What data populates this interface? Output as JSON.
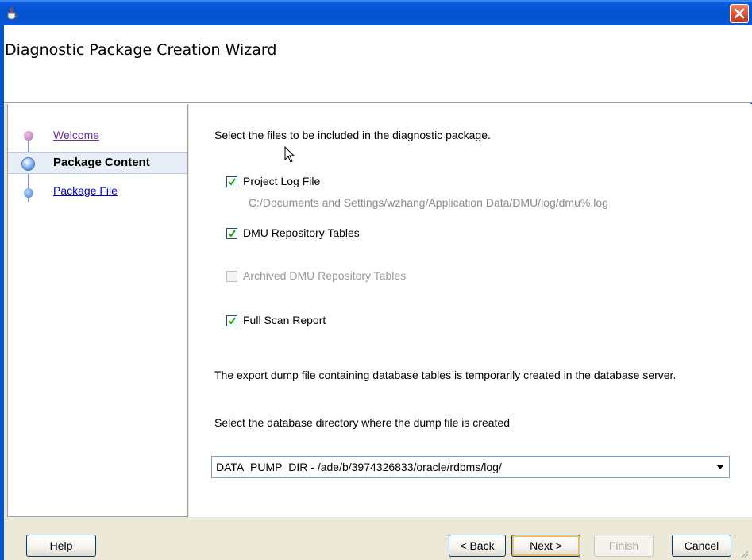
{
  "window": {
    "title": "",
    "icon": "java-cup-icon",
    "close_icon": "close-icon"
  },
  "header": {
    "title": "Diagnostic Package Creation Wizard"
  },
  "nav": {
    "items": [
      {
        "label": "Welcome",
        "state": "visited"
      },
      {
        "label": "Package Content",
        "state": "current"
      },
      {
        "label": "Package File",
        "state": "pending"
      }
    ]
  },
  "content": {
    "instruction": "Select the files to be included in the diagnostic package.",
    "options": [
      {
        "label": "Project Log File",
        "checked": true,
        "enabled": true
      },
      {
        "label": "DMU Repository Tables",
        "checked": true,
        "enabled": true
      },
      {
        "label": "Archived DMU Repository Tables",
        "checked": false,
        "enabled": false
      },
      {
        "label": "Full Scan Report",
        "checked": true,
        "enabled": true
      }
    ],
    "log_path": "C:/Documents and Settings/wzhang/Application Data/DMU/log/dmu%.log",
    "export_note": "The export dump file containing database tables is temporarily created in the database server.",
    "dir_label": "Select the database directory where the dump file is created",
    "dir_selected": "DATA_PUMP_DIR - /ade/b/3974326833/oracle/rdbms/log/"
  },
  "footer": {
    "help": "Help",
    "back": "< Back",
    "next": "Next >",
    "finish": "Finish",
    "cancel": "Cancel"
  },
  "colors": {
    "titlebar": "#0453cf",
    "panel_bg": "#ece9d8",
    "checkbox_tick": "#21a121",
    "link_visited": "#6a2ea0",
    "link": "#0000cc"
  }
}
